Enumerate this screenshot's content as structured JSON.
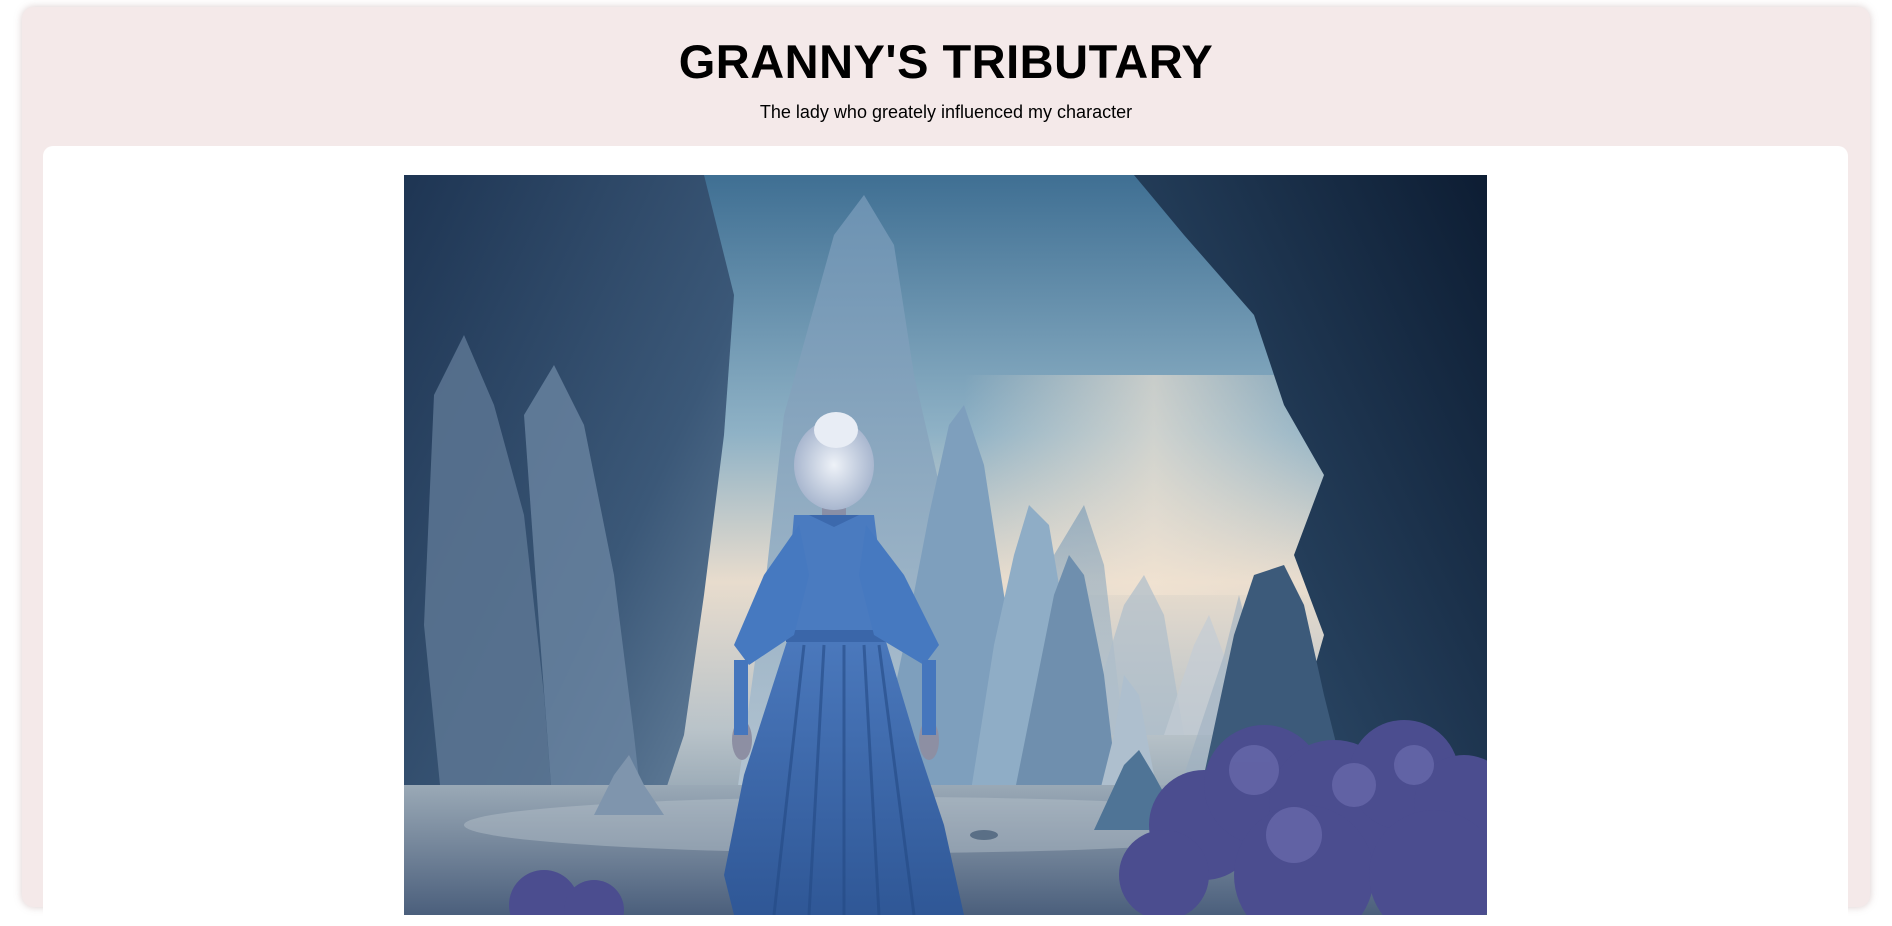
{
  "header": {
    "title": "GRANNY'S TRIBUTARY",
    "subtitle": "The lady who greately influenced my character"
  },
  "main": {
    "image": {
      "alt": "",
      "subject": "elderly woman with white hair in a long blue dress walking toward tall blue rock spires under a pale sky"
    }
  },
  "colors": {
    "page_background": "#f4e9e9",
    "panel_background": "#ffffff",
    "title_text": "#000000"
  }
}
